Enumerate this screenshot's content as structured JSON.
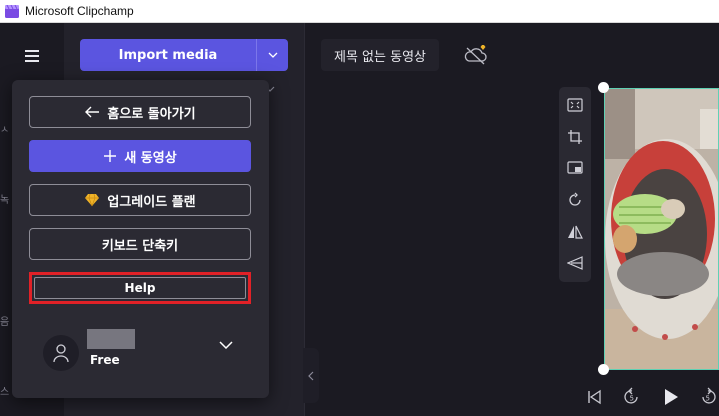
{
  "window": {
    "title": "Microsoft Clipchamp"
  },
  "left_nav": {
    "peek_labels": [
      "ㅅ",
      "녹",
      "음",
      "스"
    ]
  },
  "media_panel": {
    "import_label": "Import media"
  },
  "project": {
    "title": "제목 없는 동영상"
  },
  "menu": {
    "back_home": "홈으로 돌아가기",
    "new_video": "새 동영상",
    "upgrade": "업그레이드 플랜",
    "shortcuts": "키보드 단축키",
    "help": "Help",
    "plan": "Free"
  },
  "colors": {
    "accent": "#5b55e0",
    "highlight_box": "#e12127",
    "selection": "#5fd1b4",
    "premium": "#f0b429"
  },
  "icons": {
    "toolbar": [
      "fit-icon",
      "crop-icon",
      "pip-icon",
      "rotate-icon",
      "flip-icon",
      "volume-icon"
    ],
    "playback": [
      "skip-start-icon",
      "rewind-5-icon",
      "play-icon",
      "forward-5-icon"
    ]
  }
}
